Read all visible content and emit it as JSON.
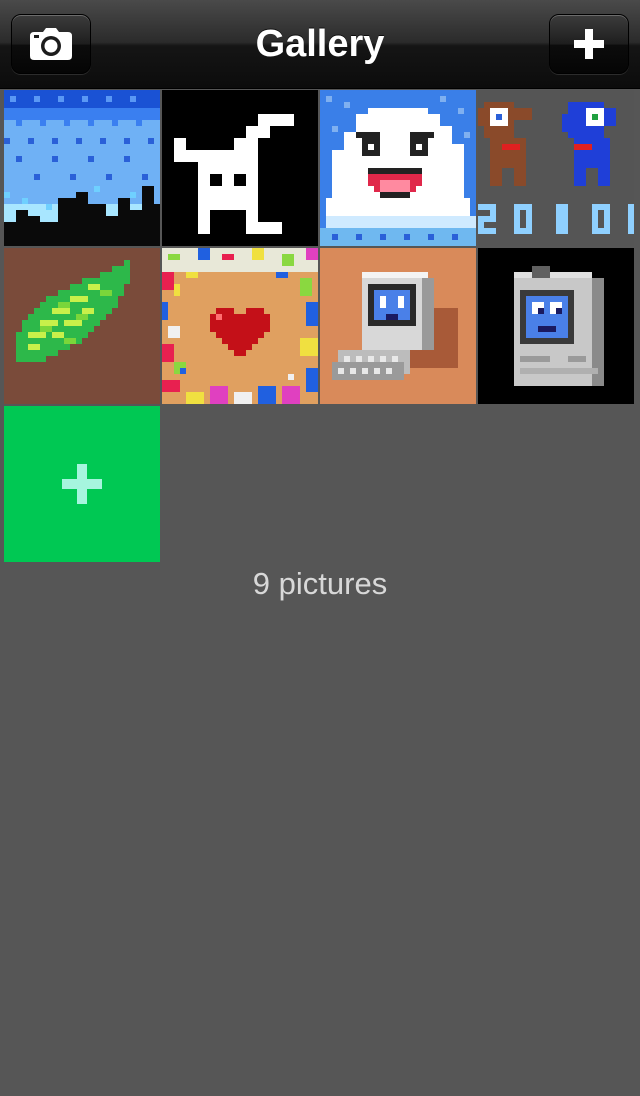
{
  "navbar": {
    "title": "Gallery",
    "left_button_icon": "camera-icon",
    "right_button_icon": "plus-icon"
  },
  "gallery": {
    "pictures": [
      {
        "name": "pixel-city-skyline"
      },
      {
        "name": "pixel-white-rabbit"
      },
      {
        "name": "pixel-smiling-cloud"
      },
      {
        "name": "pixel-two-dogs-2010"
      },
      {
        "name": "pixel-green-leaf"
      },
      {
        "name": "pixel-heart-confetti"
      },
      {
        "name": "pixel-smiling-computer-orange"
      },
      {
        "name": "pixel-smiling-macintosh-black"
      }
    ],
    "add_tile_icon": "plus-icon",
    "add_tile_color": "#00c853",
    "count_label": "9 pictures"
  },
  "colors": {
    "background": "#565656",
    "navbar": "#1a1a1a",
    "accent_green": "#00c853"
  }
}
